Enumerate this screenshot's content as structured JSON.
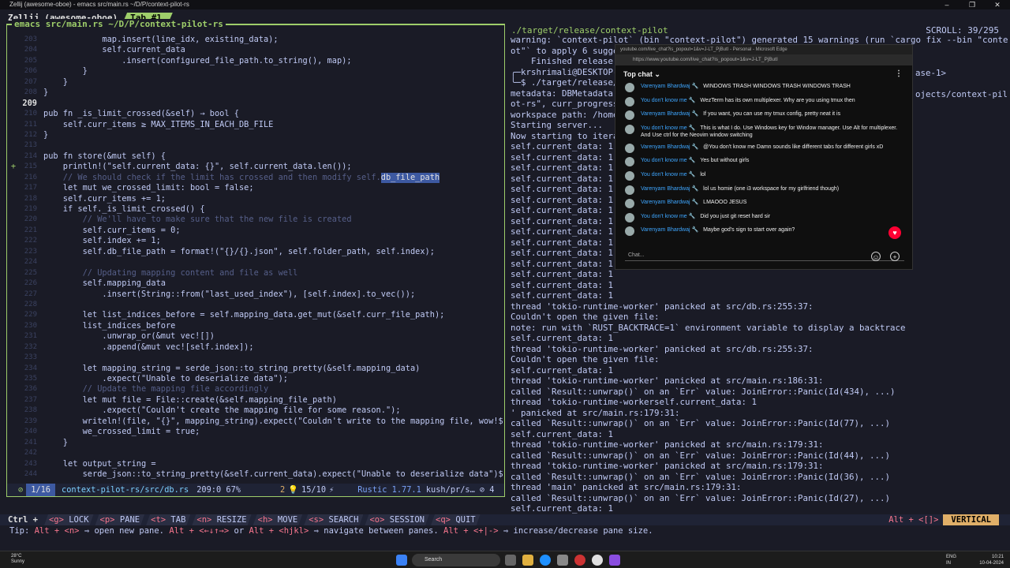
{
  "window": {
    "title": "Zellij (awesome-oboe) - emacs src/main.rs  ~/D/P/context-pilot-rs",
    "controls": [
      "–",
      "❐",
      "✕"
    ]
  },
  "zellij": {
    "session": "Zellij (awesome-oboe)",
    "tab": "Tab #1"
  },
  "left_pane": {
    "title": "emacs src/main.rs  ~/D/P/context-pilot-rs",
    "lines": [
      {
        "n": "203",
        "t": "            map.insert(line_idx, existing_data);"
      },
      {
        "n": "204",
        "t": "            self.current_data"
      },
      {
        "n": "205",
        "t": "                .insert(configured_file_path.to_string(), map);"
      },
      {
        "n": "206",
        "t": "        }"
      },
      {
        "n": "207",
        "t": "    }"
      },
      {
        "n": "208",
        "t": "}"
      },
      {
        "n": "209",
        "t": "",
        "cur": true
      },
      {
        "n": "210",
        "t": "pub fn _is_limit_crossed(&self) → bool {"
      },
      {
        "n": "211",
        "t": "    self.curr_items ≥ MAX_ITEMS_IN_EACH_DB_FILE"
      },
      {
        "n": "212",
        "t": "}"
      },
      {
        "n": "213",
        "t": ""
      },
      {
        "n": "214",
        "t": "pub fn store(&mut self) {"
      },
      {
        "n": "215",
        "t": "    println!(\"self.current_data: {}\", self.current_data.len());",
        "mod": true
      },
      {
        "n": "216",
        "t": "    // We should check if the limit has crossed and then modify self.",
        "cmt": true,
        "hl": "db_file_path"
      },
      {
        "n": "217",
        "t": "    let mut we_crossed_limit: bool = false;"
      },
      {
        "n": "218",
        "t": "    self.curr_items += 1;"
      },
      {
        "n": "219",
        "t": "    if self._is_limit_crossed() {"
      },
      {
        "n": "220",
        "t": "        // We'll have to make sure that the new file is created",
        "cmt": true
      },
      {
        "n": "221",
        "t": "        self.curr_items = 0;"
      },
      {
        "n": "222",
        "t": "        self.index += 1;"
      },
      {
        "n": "223",
        "t": "        self.db_file_path = format!(\"{}/{}.json\", self.folder_path, self.index);"
      },
      {
        "n": "224",
        "t": ""
      },
      {
        "n": "225",
        "t": "        // Updating mapping content and file as well",
        "cmt": true
      },
      {
        "n": "226",
        "t": "        self.mapping_data"
      },
      {
        "n": "227",
        "t": "            .insert(String::from(\"last_used_index\"), [self.index].to_vec());"
      },
      {
        "n": "228",
        "t": ""
      },
      {
        "n": "229",
        "t": "        let list_indices_before = self.mapping_data.get_mut(&self.curr_file_path);"
      },
      {
        "n": "230",
        "t": "        list_indices_before"
      },
      {
        "n": "231",
        "t": "            .unwrap_or(&mut vec![])"
      },
      {
        "n": "232",
        "t": "            .append(&mut vec![self.index]);"
      },
      {
        "n": "233",
        "t": ""
      },
      {
        "n": "234",
        "t": "        let mapping_string = serde_json::to_string_pretty(&self.mapping_data)"
      },
      {
        "n": "235",
        "t": "            .expect(\"Unable to deserialize data\");"
      },
      {
        "n": "236",
        "t": "        // Update the mapping file accordingly",
        "cmt": true
      },
      {
        "n": "237",
        "t": "        let mut file = File::create(&self.mapping_file_path)"
      },
      {
        "n": "238",
        "t": "            .expect(\"Couldn't create the mapping file for some reason.\");"
      },
      {
        "n": "239",
        "t": "        writeln!(file, \"{}\", mapping_string).expect(\"Couldn't write to the mapping file, wow!$"
      },
      {
        "n": "240",
        "t": "        we_crossed_limit = true;"
      },
      {
        "n": "241",
        "t": "    }"
      },
      {
        "n": "242",
        "t": ""
      },
      {
        "n": "243",
        "t": "    let output_string ="
      },
      {
        "n": "244",
        "t": "        serde_json::to_string_pretty(&self.current_data).expect(\"Unable to deserialize data\")$"
      }
    ],
    "modeline": {
      "status": "⊘",
      "position": "1/16",
      "file": "context-pilot-rs/src/db.rs",
      "linecol": "209:0 67%",
      "errors": "2",
      "bulb": "💡",
      "minor": "15/10",
      "vc": "⚡",
      "lang": "Rustic 1.77.1",
      "branch": "kush/pr/s…",
      "num": "⊘ 4"
    }
  },
  "right_pane": {
    "title": "./target/release/context-pilot",
    "scroll": "SCROLL:  39/295",
    "lines": [
      "warning: `context-pilot` (bin \"context-pilot\") generated 15 warnings (run `cargo fix --bin \"context-pil",
      "ot\"` to apply 6 sugge",
      "    Finished release ",
      "╭─krshrimali@DESKTOP-",
      "╰─$ ./target/release/",
      "metadata: DBMetadata {",
      "ot-rs\", curr_progress",
      "workspace path: /home/",
      "Starting server...",
      "Now starting to itera",
      "self.current_data: 1",
      "self.current_data: 1",
      "self.current_data: 1",
      "self.current_data: 1",
      "self.current_data: 1",
      "self.current_data: 1",
      "self.current_data: 1",
      "self.current_data: 1",
      "self.current_data: 1",
      "self.current_data: 1",
      "self.current_data: 1",
      "self.current_data: 1",
      "self.current_data: 1",
      "self.current_data: 1",
      "self.current_data: 1",
      "thread 'tokio-runtime-worker' panicked at src/db.rs:255:37:",
      "Couldn't open the given file:",
      "note: run with `RUST_BACKTRACE=1` environment variable to display a backtrace",
      "self.current_data: 1",
      "thread 'tokio-runtime-worker' panicked at src/db.rs:255:37:",
      "Couldn't open the given file:",
      "self.current_data: 1",
      "thread 'tokio-runtime-worker' panicked at src/main.rs:186:31:",
      "called `Result::unwrap()` on an `Err` value: JoinError::Panic(Id(434), ...)",
      "thread 'tokio-runtime-workerself.current_data: 1",
      "' panicked at src/main.rs:179:31:",
      "called `Result::unwrap()` on an `Err` value: JoinError::Panic(Id(77), ...)",
      "self.current_data: 1",
      "thread 'tokio-runtime-worker' panicked at src/main.rs:179:31:",
      "called `Result::unwrap()` on an `Err` value: JoinError::Panic(Id(44), ...)",
      "thread 'tokio-runtime-worker' panicked at src/main.rs:179:31:",
      "called `Result::unwrap()` on an `Err` value: JoinError::Panic(Id(36), ...)",
      "thread 'main' panicked at src/main.rs:179:31:",
      "called `Result::unwrap()` on an `Err` value: JoinError::Panic(Id(27), ...)",
      "self.current_data: 1",
      "self.current_data: 1"
    ],
    "side_fragments": [
      "ase-1>",
      "ojects/context-pil"
    ]
  },
  "chat": {
    "window_title": "youtube.com/live_chat?is_popout=1&v=J-LT_PjButI - Personal - Microsoft Edge",
    "url": "https://www.youtube.com/live_chat?is_popout=1&v=J-LT_PjButI",
    "header": "Top chat ⌄",
    "menu": "⋮",
    "messages": [
      {
        "user": "Varenyam Bhardwaj 🔧",
        "text": "WINDOWS TRASH WINDOWS TRASH WINDOWS TRASH"
      },
      {
        "user": "You don't know me 🔧",
        "text": "WezTerm has its own multiplexer. Why are you using tmux then"
      },
      {
        "user": "Varenyam Bhardwaj 🔧",
        "text": "If you want, you can use my tmux config, pretty neat it is"
      },
      {
        "user": "You don't know me 🔧",
        "text": "This is what I do. Use Windows key for Window manager. Use Alt for multiplexer. And Use ctrl for the Neovim window switching"
      },
      {
        "user": "Varenyam Bhardwaj 🔧",
        "text": "@You don't know me Damn sounds like different tabs for different girls xD"
      },
      {
        "user": "You don't know me 🔧",
        "text": "Yes but without girls"
      },
      {
        "user": "You don't know me 🔧",
        "text": "lol"
      },
      {
        "user": "Varenyam Bhardwaj 🔧",
        "text": "lol us homie (one i3 workspace for my girlfriend though)"
      },
      {
        "user": "Varenyam Bhardwaj 🔧",
        "text": "LMAOOO JESUS"
      },
      {
        "user": "You don't know me 🔧",
        "text": "Did you just git reset hard sir"
      },
      {
        "user": "Varenyam Bhardwaj 🔧",
        "text": "Maybe god's sign to start over again?"
      }
    ],
    "input_placeholder": "Chat...",
    "emoji_btn": "☺",
    "add_btn": "+",
    "heart": "♥"
  },
  "statusbar": {
    "ctrl": "Ctrl +",
    "keys": [
      {
        "k": "<g>",
        "label": "LOCK"
      },
      {
        "k": "<p>",
        "label": "PANE"
      },
      {
        "k": "<t>",
        "label": "TAB"
      },
      {
        "k": "<n>",
        "label": "RESIZE"
      },
      {
        "k": "<h>",
        "label": "MOVE"
      },
      {
        "k": "<s>",
        "label": "SEARCH"
      },
      {
        "k": "<o>",
        "label": "SESSION"
      },
      {
        "k": "<q>",
        "label": "QUIT"
      }
    ],
    "alt": "Alt + <[]>",
    "layout": "VERTICAL",
    "tip_prefix": "Tip: ",
    "tip_k1": "Alt + <n>",
    "tip_t1": " ⇒ open new pane. ",
    "tip_k2": "Alt + <←↓↑→>",
    "tip_t2": " or ",
    "tip_k3": "Alt + <hjkl>",
    "tip_t3": " ⇒ navigate between panes. ",
    "tip_k4": "Alt + <+|->",
    "tip_t4": " ⇒ increase/decrease pane size."
  },
  "taskbar": {
    "temp": "28°C",
    "weather": "Sunny",
    "search": "Search",
    "lang1": "ENG",
    "lang2": "IN",
    "time": "10:21",
    "date": "10-04-2024"
  }
}
